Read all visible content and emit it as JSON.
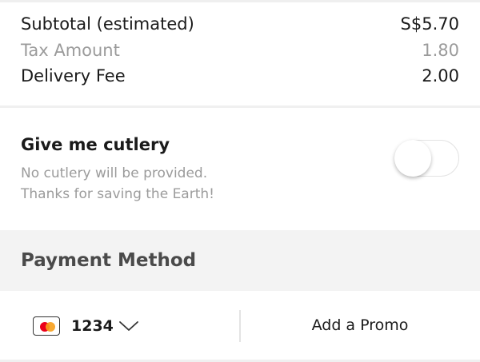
{
  "summary": {
    "subtotal_label": "Subtotal (estimated)",
    "subtotal_value": "S$5.70",
    "tax_label": "Tax Amount",
    "tax_value": "1.80",
    "delivery_label": "Delivery Fee",
    "delivery_value": "2.00"
  },
  "cutlery": {
    "title": "Give me cutlery",
    "description_line1": "No cutlery will be provided.",
    "description_line2": "Thanks for saving the Earth!",
    "toggle_on": false
  },
  "payment": {
    "title": "Payment Method",
    "card_icon": "mastercard-icon",
    "card_number": "1234",
    "dropdown_icon": "chevron-down-icon",
    "promo_label": "Add a Promo"
  },
  "colors": {
    "muted_text": "#9b9b9b",
    "section_bg": "#f3f3f3",
    "mastercard_red": "#eb001b",
    "mastercard_yellow": "#f79e1b"
  }
}
